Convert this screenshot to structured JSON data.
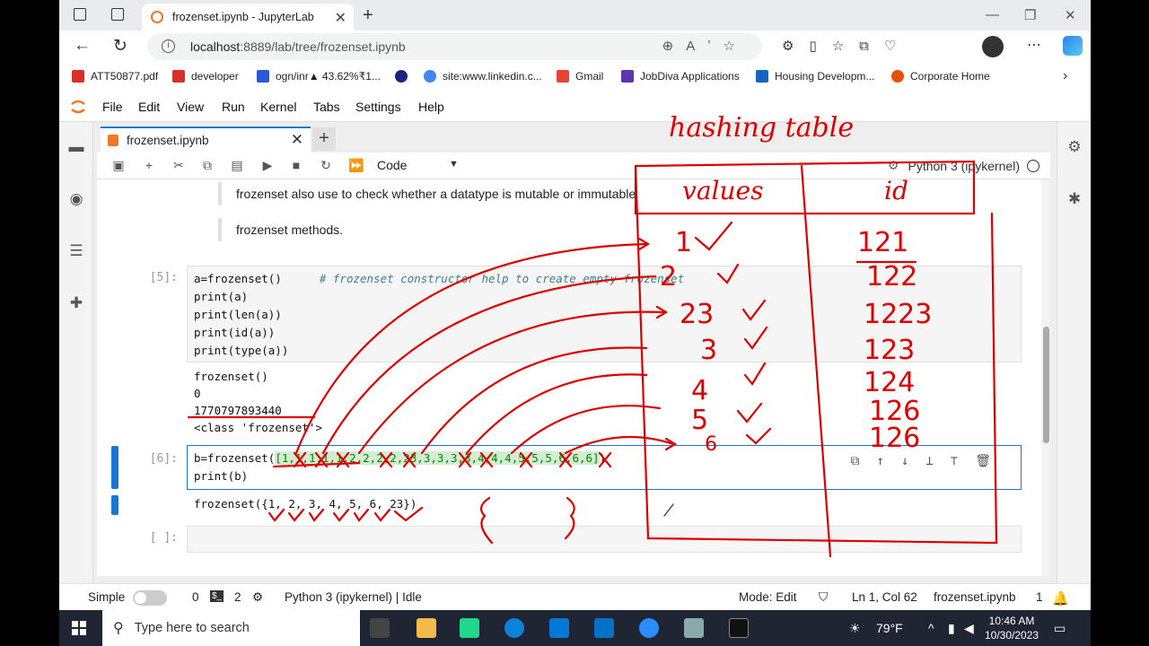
{
  "browser": {
    "tab_title": "frozenset.ipynb - JupyterLab",
    "url_host": "localhost",
    "url_rest": ":8889/lab/tree/frozenset.ipynb",
    "favorites": [
      {
        "label": "ATT50877.pdf",
        "color": "#d93025"
      },
      {
        "label": "developer",
        "color": "#d93025"
      },
      {
        "label": "ogn/inr▲ 43.62%₹1...",
        "color": "#2b57d9"
      },
      {
        "label": "",
        "color": "#1a237e"
      },
      {
        "label": "site:www.linkedin.c...",
        "color": "#4285f4"
      },
      {
        "label": "Gmail",
        "color": "#ea4335"
      },
      {
        "label": "JobDiva Applications",
        "color": "#5e35b1"
      },
      {
        "label": "Housing Developm...",
        "color": "#1565c0"
      },
      {
        "label": "Corporate Home",
        "color": "#e65100"
      }
    ]
  },
  "menu": [
    "File",
    "Edit",
    "View",
    "Run",
    "Kernel",
    "Tabs",
    "Settings",
    "Help"
  ],
  "notebook": {
    "tab_label": "frozenset.ipynb",
    "cell_type": "Code",
    "kernel": "Python 3 (ipykernel)",
    "md1": "frozenset also use to check whether a datatype is mutable or immutable",
    "md2": "frozenset methods.",
    "cell5": {
      "prompt": "[5]:",
      "lines": [
        "a=frozenset()",
        "print(a)",
        "print(len(a))",
        "print(id(a))",
        "print(type(a))"
      ],
      "comment": "# frozenset constructor help to create empty frozenset",
      "output": "frozenset()\n0\n1770797893440\n<class 'frozenset'>"
    },
    "cell6": {
      "prompt": "[6]:",
      "line1_prefix": "b=frozenset(",
      "line1_arg": "[1,1,1,1,1,2,2,2,2,23,3,3,3,3,4,4,4,5,5,5,6,6,6]",
      "line1_suffix": ")",
      "line2": "print(b)",
      "output": "frozenset({1, 2, 3, 4, 5, 6, 23})"
    },
    "cell7": {
      "prompt": "[ ]:"
    }
  },
  "status": {
    "simple": "Simple",
    "count1": "0",
    "count2": "2",
    "kernel_status": "Python 3 (ipykernel) | Idle",
    "mode": "Mode: Edit",
    "position": "Ln 1, Col 62",
    "filename": "frozenset.ipynb",
    "notifications": "1"
  },
  "taskbar": {
    "search_placeholder": "Type here to search",
    "weather": "79°F",
    "time": "10:46 AM",
    "date": "10/30/2023"
  },
  "handwriting": {
    "title": "hashing table",
    "col_values": "values",
    "col_id": "id",
    "values": [
      "1",
      "2",
      "23",
      "3",
      "4",
      "5",
      "6"
    ],
    "ids": [
      "121",
      "122",
      "1223",
      "123",
      "124",
      "126",
      "126"
    ]
  }
}
